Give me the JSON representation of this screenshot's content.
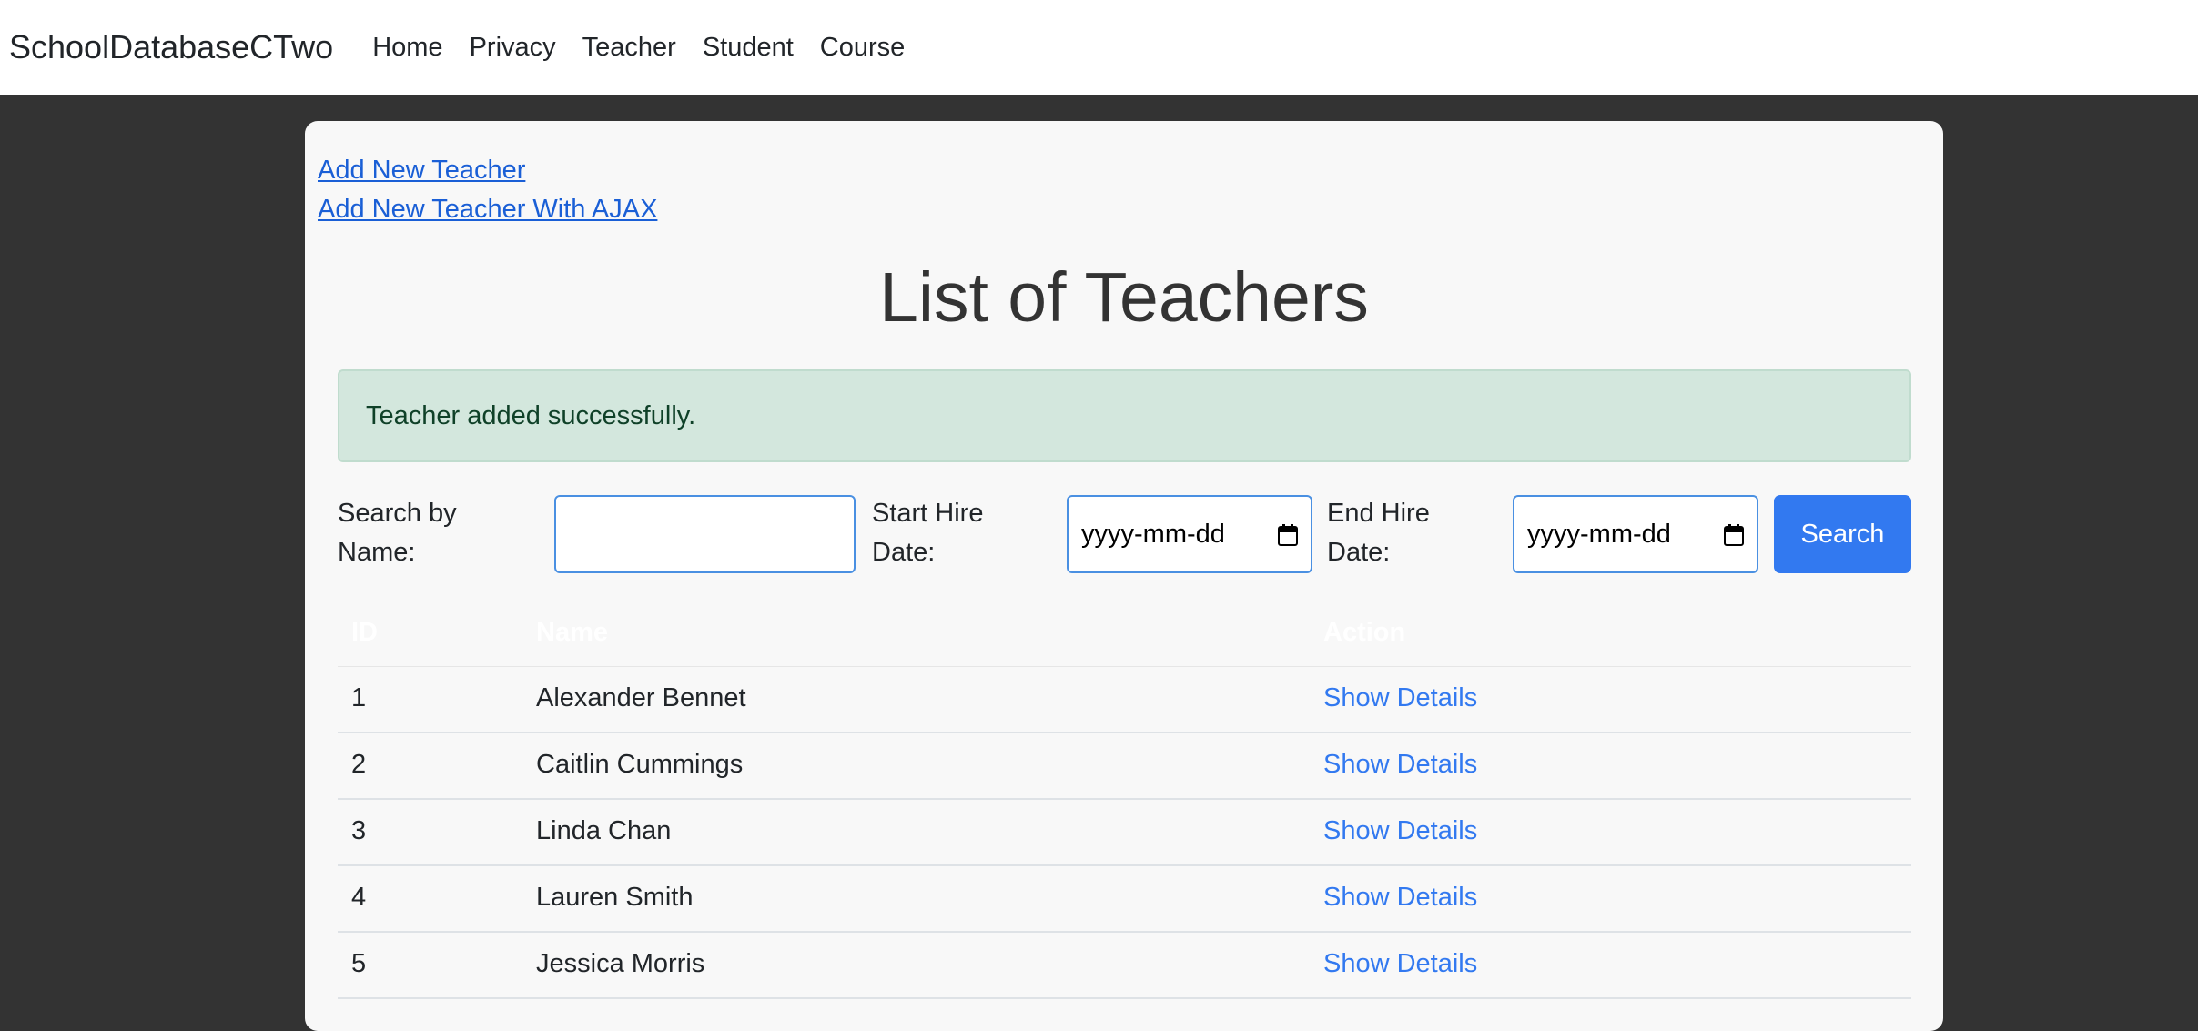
{
  "nav": {
    "brand": "SchoolDatabaseCTwo",
    "links": [
      "Home",
      "Privacy",
      "Teacher",
      "Student",
      "Course"
    ]
  },
  "links": {
    "add_new": "Add New Teacher",
    "add_new_ajax": "Add New Teacher With AJAX"
  },
  "page": {
    "title": "List of Teachers",
    "alert": "Teacher added successfully."
  },
  "search": {
    "name_label": "Search by Name:",
    "name_value": "",
    "start_label": "Start Hire Date:",
    "start_placeholder": "yyyy-mm-dd",
    "end_label": "End Hire Date:",
    "end_placeholder": "yyyy-mm-dd",
    "button": "Search"
  },
  "table": {
    "headers": [
      "ID",
      "Name",
      "Action"
    ],
    "rows": [
      {
        "id": "1",
        "name": "Alexander Bennet",
        "action": "Show Details"
      },
      {
        "id": "2",
        "name": "Caitlin Cummings",
        "action": "Show Details"
      },
      {
        "id": "3",
        "name": "Linda Chan",
        "action": "Show Details"
      },
      {
        "id": "4",
        "name": "Lauren Smith",
        "action": "Show Details"
      },
      {
        "id": "5",
        "name": "Jessica Morris",
        "action": "Show Details"
      }
    ]
  },
  "colors": {
    "page_bg": "#333333",
    "card_bg": "#f8f8f8",
    "alert_bg": "#d3e7dd",
    "alert_text": "#0f4128",
    "accent": "#3279f0",
    "link": "#1a5fd6"
  },
  "icons": [
    "calendar-icon"
  ]
}
